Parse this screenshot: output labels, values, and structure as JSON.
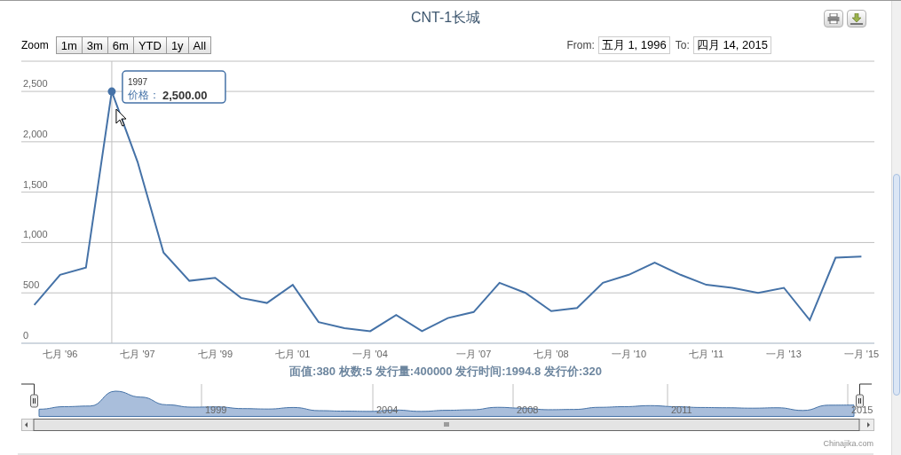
{
  "title": "CNT-1长城",
  "zoom": {
    "label": "Zoom",
    "buttons": [
      {
        "label": "1m",
        "selected": false
      },
      {
        "label": "3m",
        "selected": false
      },
      {
        "label": "6m",
        "selected": false
      },
      {
        "label": "YTD",
        "selected": false
      },
      {
        "label": "1y",
        "selected": false
      },
      {
        "label": "All",
        "selected": false
      }
    ]
  },
  "range": {
    "from_label": "From:",
    "from": "五月 1, 1996",
    "to_label": "To:",
    "to": "四月 14, 2015"
  },
  "chart_data": {
    "type": "line",
    "categories": [
      null,
      "七月 '96",
      null,
      null,
      "七月 '97",
      null,
      null,
      "七月 '99",
      null,
      null,
      "七月 '01",
      null,
      null,
      "一月 '04",
      null,
      null,
      null,
      "一月 '07",
      null,
      null,
      "七月 '08",
      null,
      null,
      "一月 '10",
      null,
      null,
      "七月 '11",
      null,
      null,
      "一月 '13",
      null,
      null,
      "一月 '15"
    ],
    "grid": true,
    "ylim": [
      0,
      2800
    ],
    "yticks": [
      0,
      500,
      {
        "value": 1000,
        "label": "1,000"
      },
      {
        "value": 1500,
        "label": "1,500"
      },
      {
        "value": 2000,
        "label": "2,000"
      },
      {
        "value": 2500,
        "label": "2,500"
      }
    ],
    "series": [
      {
        "color": "#4572a7",
        "values": [
          380,
          680,
          750,
          2500,
          1800,
          900,
          620,
          650,
          450,
          400,
          580,
          210,
          150,
          120,
          280,
          120,
          250,
          310,
          600,
          500,
          320,
          350,
          600,
          680,
          800,
          680,
          580,
          550,
          500,
          550,
          230,
          850,
          860
        ]
      }
    ]
  },
  "tooltip": {
    "date": "1997",
    "label": "价格：",
    "value": "2,500.00"
  },
  "subtitle": "面值:380 枚数:5 发行量:400000 发行时间:1994.8 发行价:320",
  "navigator": {
    "labels": [
      "1999",
      "2004",
      "2008",
      "2011",
      "2015"
    ]
  },
  "credits": "Chinajika.com"
}
